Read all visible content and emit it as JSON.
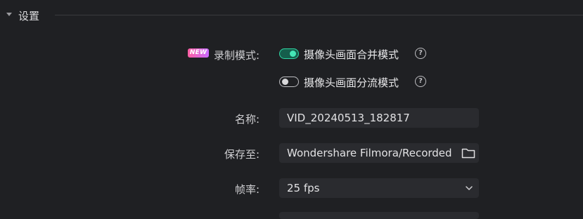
{
  "section": {
    "title": "设置"
  },
  "mode": {
    "label": "录制模式:",
    "badge": "NEW",
    "options": [
      {
        "label": "摄像头画面合并模式",
        "state": "on"
      },
      {
        "label": "摄像头画面分流模式",
        "state": "off"
      }
    ],
    "help_glyph": "?"
  },
  "name": {
    "label": "名称:",
    "value": "VID_20240513_182817"
  },
  "save_to": {
    "label": "保存至:",
    "value": "Wondershare Filmora/Recorded",
    "icon": "folder-icon"
  },
  "frame_rate": {
    "label": "帧率:",
    "value": "25 fps",
    "icon": "chevron-down-icon"
  },
  "colors": {
    "accent": "#2fd6a3",
    "background": "#1f2023",
    "field": "#2a2b2f"
  }
}
